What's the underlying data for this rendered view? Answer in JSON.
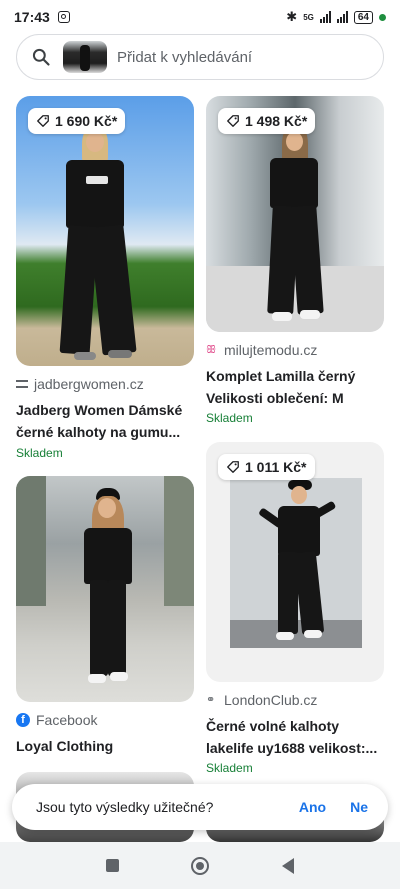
{
  "status_bar": {
    "time": "17:43",
    "network": "5G",
    "battery": "64"
  },
  "search": {
    "placeholder": "Přidat k vyhledávání"
  },
  "results": [
    {
      "price": "1 690 Kč*",
      "source": "jadbergwomen.cz",
      "title_line1": "Jadberg Women Dámské",
      "title_line2": "černé kalhoty na gumu...",
      "stock": "Skladem"
    },
    {
      "price": "1 498 Kč*",
      "source": "milujtemodu.cz",
      "title_line1": "Komplet Lamilla černý",
      "title_line2": "Velikosti oblečení: M",
      "stock": "Skladem"
    },
    {
      "price": "",
      "source": "Facebook",
      "title_line1": "Loyal Clothing",
      "title_line2": "",
      "stock": ""
    },
    {
      "price": "1 011 Kč*",
      "source": "LondonClub.cz",
      "title_line1": "Černé volné kalhoty",
      "title_line2": "lakelife uy1688 velikost:...",
      "stock": "Skladem"
    }
  ],
  "feedback": {
    "question": "Jsou tyto výsledky užitečné?",
    "yes": "Ano",
    "no": "Ne"
  },
  "icons": {
    "search": "search-icon",
    "price_tag": "price-tag-icon",
    "nav_recents": "square-icon",
    "nav_home": "circle-home-icon",
    "nav_back": "triangle-back-icon"
  },
  "colors": {
    "stock_green": "#188038",
    "link_blue": "#1a73e8",
    "facebook_blue": "#1877f2"
  }
}
